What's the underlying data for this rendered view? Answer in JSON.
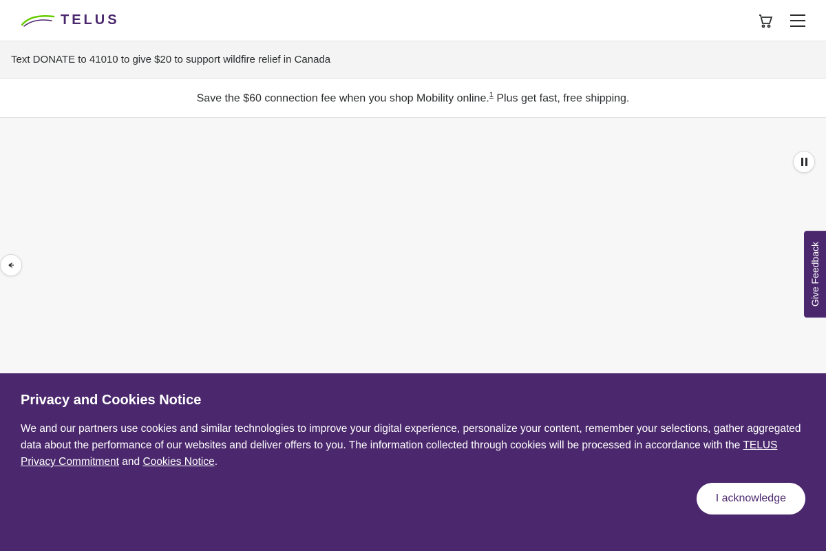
{
  "brand": {
    "name": "TELUS",
    "logo_color_primary": "#66cc00",
    "logo_color_text": "#4b286d"
  },
  "announcement": {
    "text": "Text DONATE to 41010 to give $20 to support wildfire relief in Canada"
  },
  "promo": {
    "text_before": "Save the $60 connection fee when you shop Mobility online.",
    "footnote": "1",
    "text_after": " Plus get fast, free shipping."
  },
  "feedback": {
    "label": "Give Feedback"
  },
  "cookie_notice": {
    "title": "Privacy and Cookies Notice",
    "body_part1": "We and our partners use cookies and similar technologies to improve your digital experience, personalize your content, remember your selections, gather aggregated data about the performance of our websites and deliver offers to you. The information collected through cookies will be processed in accordance with the ",
    "link1": "TELUS Privacy Commitment",
    "body_part2": " and ",
    "link2": "Cookies Notice",
    "body_part3": ".",
    "ack_label": "I acknowledge"
  },
  "colors": {
    "purple": "#4b286d",
    "green": "#66cc00"
  }
}
